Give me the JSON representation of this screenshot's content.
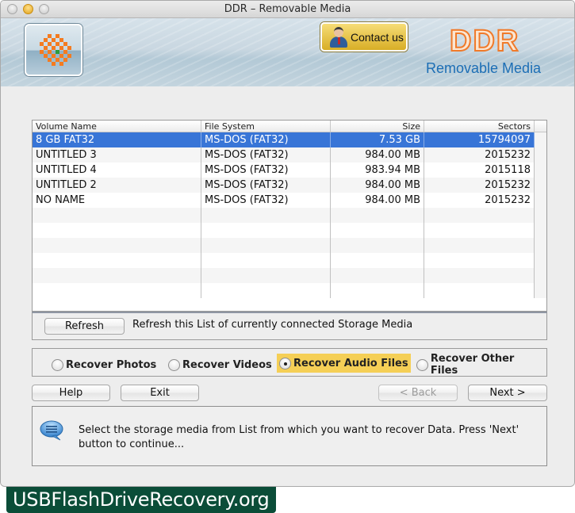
{
  "window": {
    "title": "DDR – Removable Media"
  },
  "banner": {
    "contact_label": "Contact us",
    "brand_title": "DDR",
    "brand_subtitle": "Removable Media"
  },
  "table": {
    "columns": [
      "Volume Name",
      "File System",
      "Size",
      "Sectors"
    ],
    "rows": [
      {
        "volume": "8 GB FAT32",
        "fs": "MS-DOS (FAT32)",
        "size": "7.53  GB",
        "sectors": "15794097",
        "selected": true
      },
      {
        "volume": "UNTITLED 3",
        "fs": "MS-DOS (FAT32)",
        "size": "984.00  MB",
        "sectors": "2015232",
        "selected": false
      },
      {
        "volume": "UNTITLED 4",
        "fs": "MS-DOS (FAT32)",
        "size": "983.94  MB",
        "sectors": "2015118",
        "selected": false
      },
      {
        "volume": "UNTITLED 2",
        "fs": "MS-DOS (FAT32)",
        "size": "984.00  MB",
        "sectors": "2015232",
        "selected": false
      },
      {
        "volume": "NO NAME",
        "fs": "MS-DOS (FAT32)",
        "size": "984.00  MB",
        "sectors": "2015232",
        "selected": false
      }
    ]
  },
  "refresh": {
    "button_label": "Refresh",
    "description": "Refresh this List of currently connected Storage Media"
  },
  "recovery_options": [
    {
      "label": "Recover Photos",
      "checked": false
    },
    {
      "label": "Recover Videos",
      "checked": false
    },
    {
      "label": "Recover Audio Files",
      "checked": true
    },
    {
      "label": "Recover Other Files",
      "checked": false
    }
  ],
  "nav": {
    "help_label": "Help",
    "exit_label": "Exit",
    "back_label": "< Back",
    "next_label": "Next >"
  },
  "info": {
    "message": "Select the storage media from List from which you want to recover Data. Press 'Next' button to continue..."
  },
  "watermark": {
    "text": "USBFlashDriveRecovery.org"
  }
}
